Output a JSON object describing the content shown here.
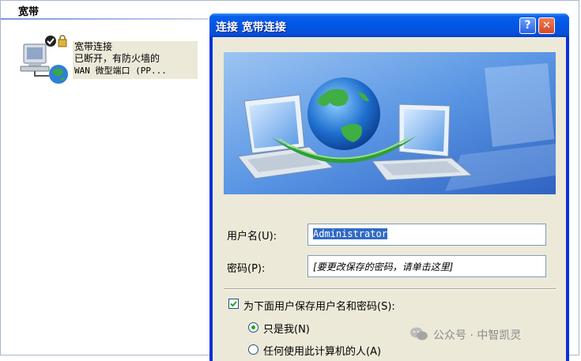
{
  "section": {
    "title": "宽带"
  },
  "connection": {
    "name": "宽带连接",
    "status_line": "已断开，有防火墙的",
    "device_line": "WAN 微型端口 (PP..."
  },
  "dialog": {
    "title": "连接 宽带连接",
    "help_glyph": "?",
    "close_glyph": "✕",
    "username_label": "用户名(U):",
    "username_value": "Administrator",
    "password_label": "密码(P):",
    "password_placeholder": "[要更改保存的密码，请单击这里]",
    "save_checkbox_label": "为下面用户保存用户名和密码(S):",
    "save_checked": true,
    "radio_options": [
      {
        "label": "只是我(N)",
        "selected": true
      },
      {
        "label": "任何使用此计算机的人(A)",
        "selected": false
      }
    ]
  },
  "watermark": {
    "text": "公众号 · 中智凯灵"
  },
  "colors": {
    "titlebar": "#0056e5",
    "dialog_bg": "#ece9d8",
    "selection": "#316ac5",
    "radio_dot": "#21a121"
  }
}
